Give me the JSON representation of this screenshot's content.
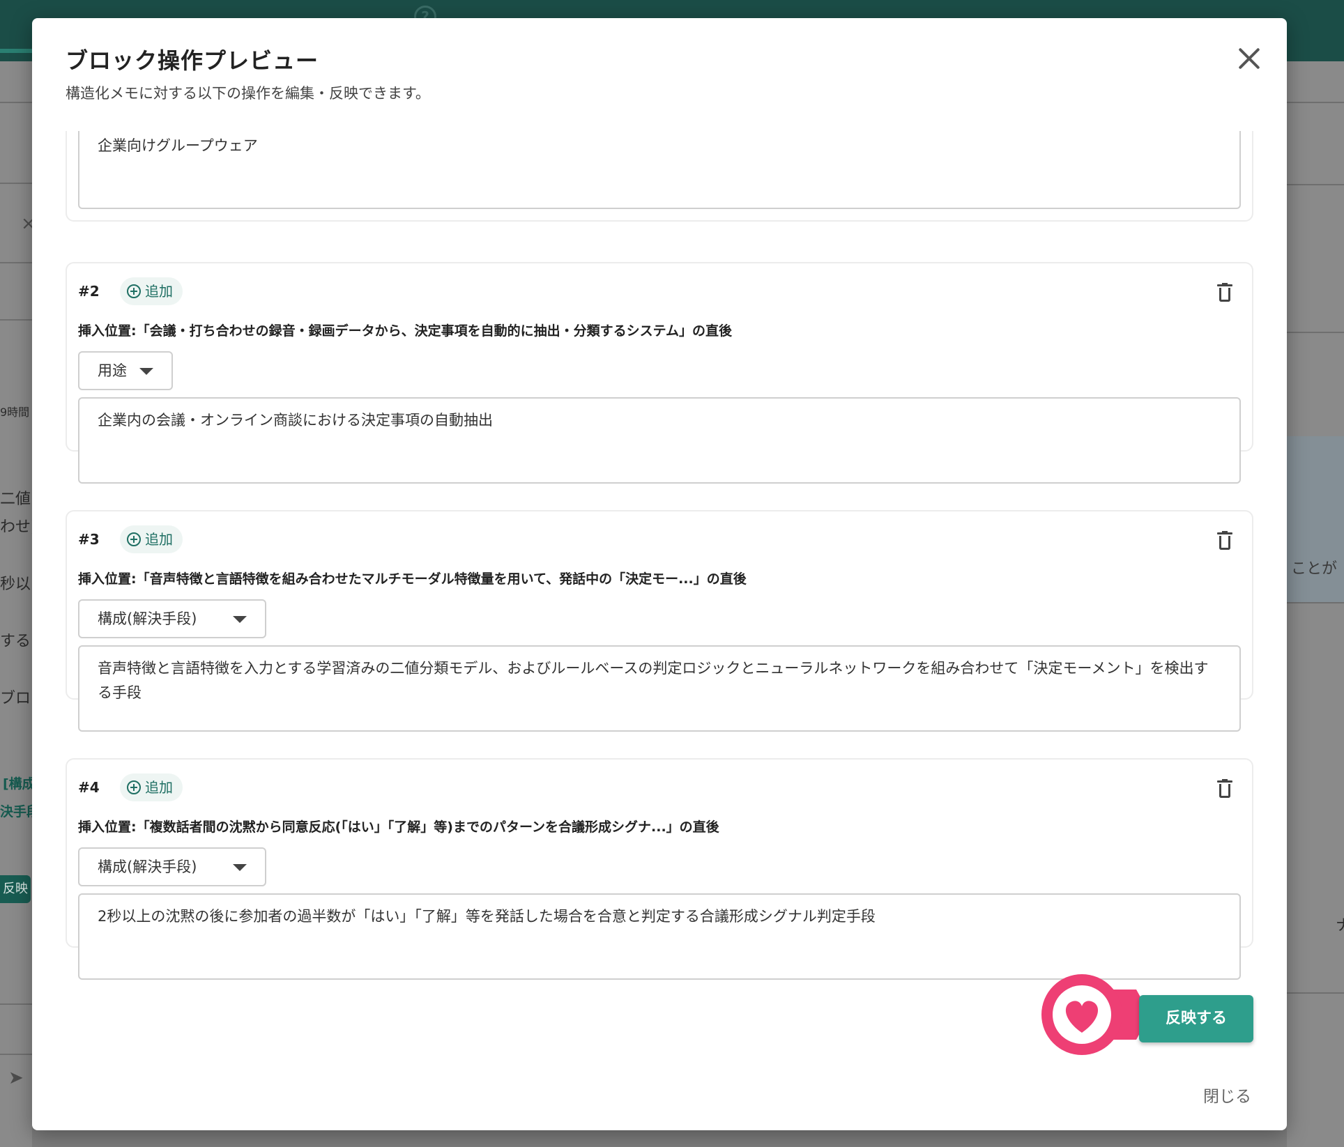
{
  "background": {
    "fragments": {
      "time": "9時間",
      "line1": "二値",
      "line2": "わせ)",
      "line3": "秒以",
      "line4": "する",
      "line5": "ブロ",
      "teal1": "[構成",
      "teal2": "決手段",
      "btn": "反映",
      "right1": "ことが",
      "right2": "ナ"
    }
  },
  "modal": {
    "title": "ブロック操作プレビュー",
    "subtitle": "構造化メモに対する以下の操作を編集・反映できます。",
    "first_card_text": "企業向けグループウェア",
    "cards": [
      {
        "num": "#2",
        "badge": "追加",
        "insert_position": "挿入位置:「会議・打ち合わせの録音・録画データから、決定事項を自動的に抽出・分類するシステム」の直後",
        "select": "用途",
        "text": "企業内の会議・オンライン商談における決定事項の自動抽出"
      },
      {
        "num": "#3",
        "badge": "追加",
        "insert_position": "挿入位置:「音声特徴と言語特徴を組み合わせたマルチモーダル特徴量を用いて、発話中の「決定モー...」の直後",
        "select": "構成(解決手段)",
        "text": "音声特徴と言語特徴を入力とする学習済みの二値分類モデル、およびルールベースの判定ロジックとニューラルネットワークを組み合わせて「決定モーメント」を検出する手段"
      },
      {
        "num": "#4",
        "badge": "追加",
        "insert_position": "挿入位置:「複数話者間の沈黙から同意反応(「はい」「了解」等)までのパターンを合議形成シグナ...」の直後",
        "select": "構成(解決手段)",
        "text": "2秒以上の沈黙の後に参加者の過半数が「はい」「了解」等を発話した場合を合意と判定する合議形成シグナル判定手段"
      }
    ],
    "apply_button": "反映する",
    "close_link": "閉じる"
  },
  "colors": {
    "accent": "#2e9e8c",
    "header": "#1b4d47",
    "marker": "#ee3f74"
  },
  "icons": [
    "help-icon",
    "close-icon",
    "plus-circle-icon",
    "trash-icon",
    "chevron-down-icon",
    "heart-icon",
    "send-icon"
  ]
}
